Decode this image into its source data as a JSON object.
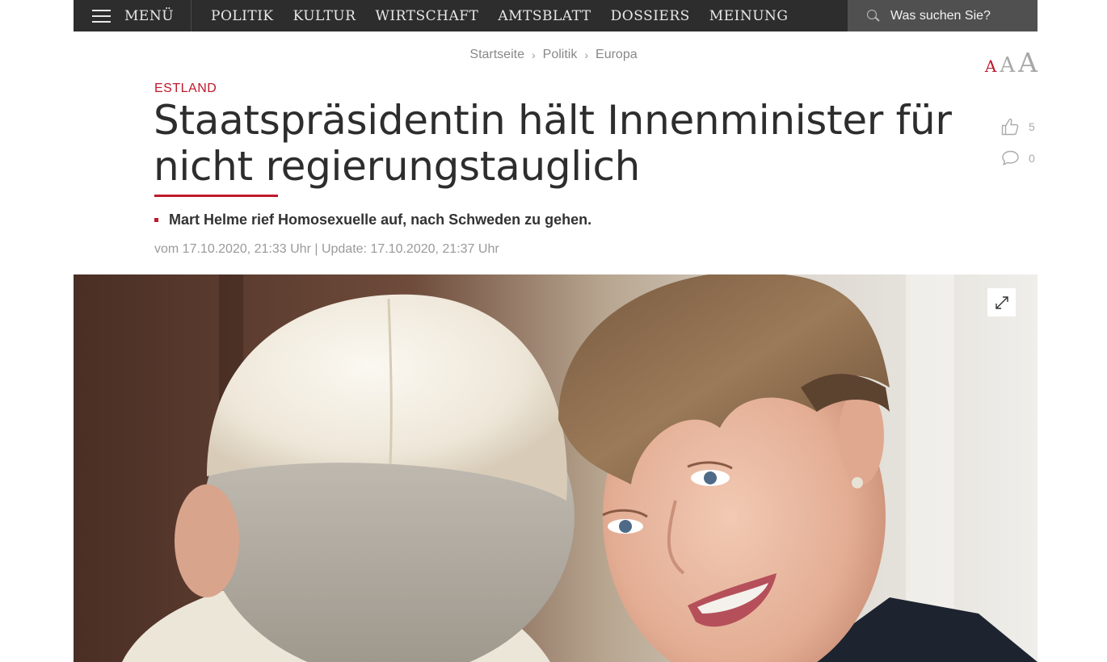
{
  "nav": {
    "menu_label": "MENÜ",
    "links": [
      "POLITIK",
      "KULTUR",
      "WIRTSCHAFT",
      "AMTSBLATT",
      "DOSSIERS",
      "MEINUNG"
    ],
    "search_placeholder": "Was suchen Sie?"
  },
  "breadcrumb": [
    "Startseite",
    "Politik",
    "Europa"
  ],
  "font_size_controls": [
    "A",
    "A",
    "A"
  ],
  "article": {
    "kicker": "ESTLAND",
    "headline": "Staatspräsidentin hält Innenminister für nicht regierungstauglich",
    "lead": "Mart Helme rief Homosexuelle auf, nach Schweden zu gehen.",
    "dateline": "vom 17.10.2020, 21:33 Uhr | Update: 17.10.2020, 21:37 Uhr"
  },
  "social": {
    "likes": "5",
    "comments": "0"
  },
  "colors": {
    "nav_bg": "#2d2d2d",
    "search_bg": "#505050",
    "accent": "#c0182b",
    "headline": "#2d2d2d",
    "meta": "#9a9a9a"
  },
  "icons": [
    "hamburger-icon",
    "search-icon",
    "thumbs-up-icon",
    "comment-icon",
    "expand-icon"
  ]
}
